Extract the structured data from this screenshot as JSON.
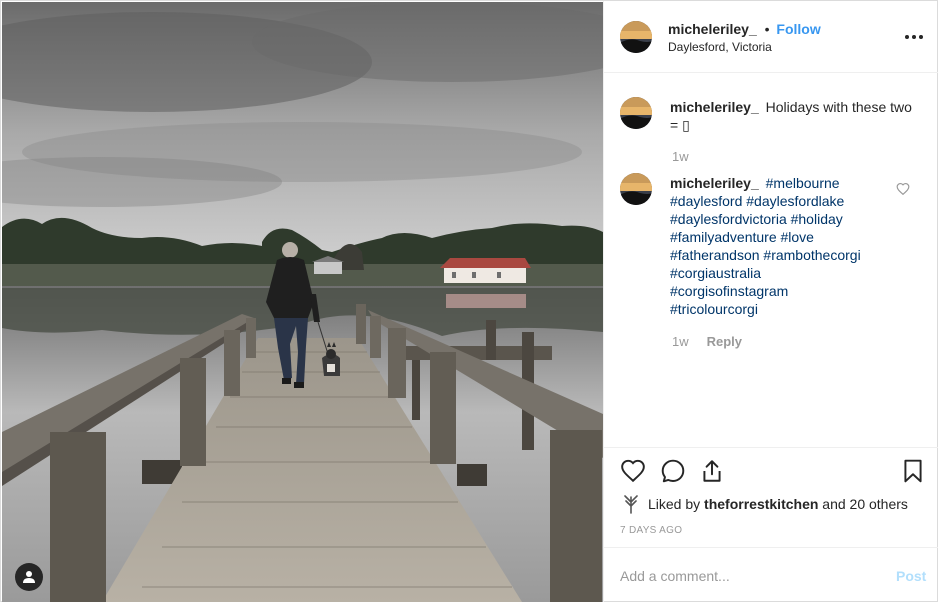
{
  "post": {
    "username": "micheleriley_",
    "follow_separator": "•",
    "follow_label": "Follow",
    "location": "Daylesford, Victoria",
    "more_icon": "more-options-icon"
  },
  "caption": {
    "username": "micheleriley_",
    "text": "Holidays with these two",
    "text_line2": "= ▯",
    "age": "1w"
  },
  "comment": {
    "username": "micheleriley_",
    "hashtags": [
      "#melbourne",
      "#daylesford #daylesfordlake",
      "#daylesfordvictoria #holiday",
      "#familyadventure #love",
      "#fatherandson #rambothecorgi",
      "#corgiaustralia",
      "#corgisofinstagram",
      "#tricolourcorgi"
    ],
    "age": "1w",
    "reply_label": "Reply"
  },
  "actions": {
    "like_icon": "heart-icon",
    "comment_icon": "comment-icon",
    "share_icon": "share-icon",
    "save_icon": "bookmark-icon",
    "liked_by_prefix": "Liked by",
    "liked_by_user": "theforrestkitchen",
    "liked_by_suffix": "and 20 others",
    "timestamp": "7 DAYS AGO"
  },
  "composer": {
    "placeholder": "Add a comment...",
    "post_label": "Post"
  },
  "colors": {
    "link": "#3897f0",
    "hashtag": "#003569",
    "muted": "#999999",
    "post_disabled": "#b2dffc"
  }
}
